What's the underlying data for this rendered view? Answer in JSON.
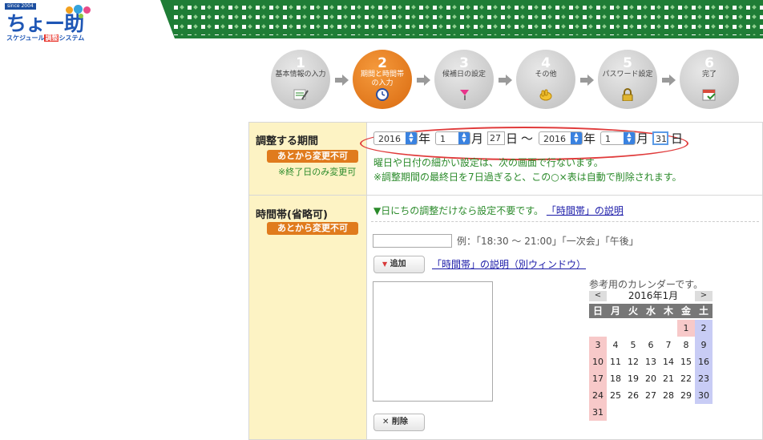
{
  "logo": {
    "since": "since 2004",
    "name": "ちょー助",
    "sub_pre": "スケジュール",
    "sub_mid": "調整",
    "sub_post": "システム"
  },
  "steps": [
    {
      "num": "1",
      "label": "基本情報の入力",
      "state": "done",
      "icon": "pencil-paper-icon"
    },
    {
      "num": "2",
      "label": "期間と時間帯の入力",
      "state": "current",
      "icon": "clock-icon"
    },
    {
      "num": "3",
      "label": "候補日の設定",
      "state": "todo",
      "icon": "flag-icon"
    },
    {
      "num": "4",
      "label": "その他",
      "state": "todo",
      "icon": "hand-icon"
    },
    {
      "num": "5",
      "label": "パスワード設定",
      "state": "todo",
      "icon": "lock-icon"
    },
    {
      "num": "6",
      "label": "完了",
      "state": "todo",
      "icon": "calendar-check-icon"
    }
  ],
  "period": {
    "title": "調整する期間",
    "badge": "あとから変更不可",
    "note": "※終了日のみ変更可",
    "start_year": "2016",
    "start_month": "1",
    "start_day": "27",
    "end_year": "2016",
    "end_month": "1",
    "end_day": "31",
    "year_unit": "年",
    "month_unit": "月",
    "day_unit": "日",
    "tilde": "〜",
    "help1": "曜日や日付の細かい設定は、次の画面で行ないます。",
    "help2": "※調整期間の最終日を7日過ぎると、この○×表は自動で削除されます。"
  },
  "timeslot": {
    "title": "時間帯(省略可)",
    "badge": "あとから変更不可",
    "info": "▼日にちの調整だけなら設定不要です。",
    "info_link": "「時間帯」の説明",
    "example": "例：「18:30 〜 21:00」「一次会」「午後」",
    "add_button": "追加",
    "add_link": "「時間帯」の説明（別ウィンドウ）",
    "delete_button": "削除"
  },
  "calendar": {
    "caption": "参考用のカレンダーです。",
    "prev": "<",
    "next": ">",
    "month": "2016年1月",
    "weekdays": [
      "日",
      "月",
      "火",
      "水",
      "木",
      "金",
      "土"
    ],
    "days": [
      "1",
      "2",
      "3",
      "4",
      "5",
      "6",
      "7",
      "8",
      "9",
      "10",
      "11",
      "12",
      "13",
      "14",
      "15",
      "16",
      "17",
      "18",
      "19",
      "20",
      "21",
      "22",
      "23",
      "24",
      "25",
      "26",
      "27",
      "28",
      "29",
      "30",
      "31"
    ]
  },
  "colors": {
    "accent": "#e07b1d",
    "banner": "#1f7d36",
    "holiday": "#f7c9c9",
    "saturday": "#c8ccf5",
    "note_green": "#2a8a2a"
  }
}
